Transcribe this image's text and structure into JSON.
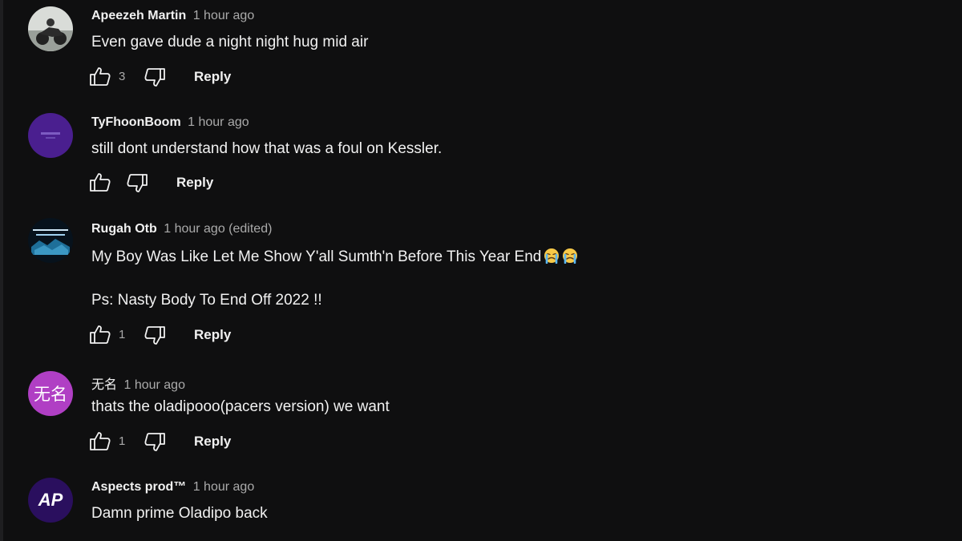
{
  "colors": {
    "background": "#0f0f10",
    "text": "#f1f1f1",
    "muted": "#aaaaaa"
  },
  "comments": [
    {
      "author": "Apeezeh Martin",
      "time": "1 hour ago",
      "text": "Even gave dude a night night hug mid air",
      "likes": "3",
      "reply_label": "Reply",
      "avatar": "motorcycle-photo-avatar"
    },
    {
      "author": "TyFhoonBoom",
      "time": "1 hour ago",
      "text": "still dont understand how that was a foul on Kessler.",
      "likes": "",
      "reply_label": "Reply",
      "avatar": "purple-logo-avatar"
    },
    {
      "author": "Rugah Otb",
      "time": "1 hour ago (edited)",
      "text_line1": "My Boy Was Like Let Me Show Y'all Sumth'n Before This Year End",
      "text_line2": "Ps: Nasty Body To End Off 2022 !!",
      "emoji": "crying-face-emoji",
      "likes": "1",
      "reply_label": "Reply",
      "avatar": "album-art-avatar"
    },
    {
      "author": "无名",
      "time": "1 hour ago",
      "text": "thats the oladipooo(pacers version) we want",
      "likes": "1",
      "reply_label": "Reply",
      "avatar_letters": "无名",
      "avatar_color": "#b03fc4"
    },
    {
      "author": "Aspects prod™",
      "time": "1 hour ago",
      "text": "Damn prime Oladipo back",
      "likes": "",
      "reply_label": "Reply",
      "avatar_letters": "AP",
      "avatar": "ap-logo-avatar"
    }
  ]
}
